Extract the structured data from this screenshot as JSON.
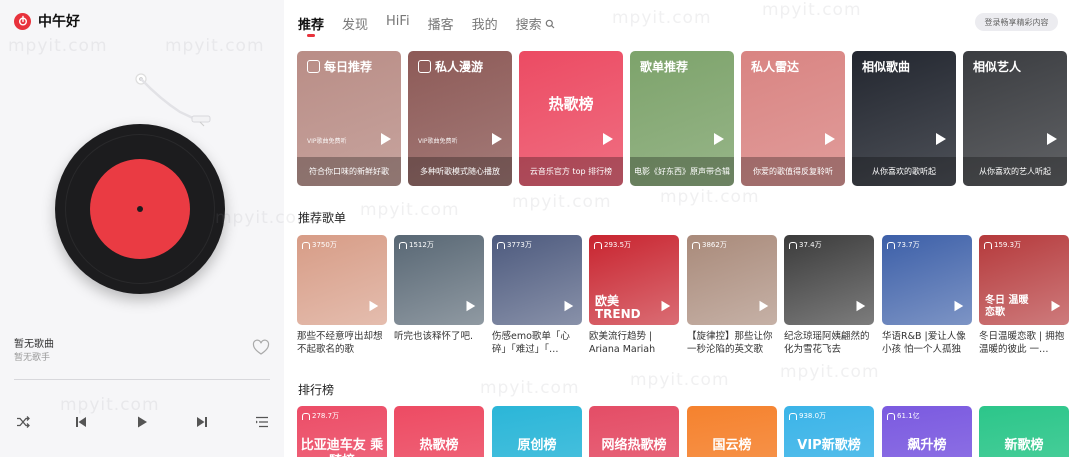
{
  "app": {
    "name": "中午好"
  },
  "player": {
    "song_title": "暂无歌曲",
    "song_artist": "暂无歌手"
  },
  "tabs": [
    {
      "label": "推荐",
      "active": true
    },
    {
      "label": "发现"
    },
    {
      "label": "HiFi"
    },
    {
      "label": "播客"
    },
    {
      "label": "我的"
    },
    {
      "label": "搜索"
    }
  ],
  "login_label": "登录畅享精彩内容",
  "feature_cards": [
    {
      "title": "每日推荐",
      "sub": "VIP歌曲免费听",
      "footer": "符合你口味的新鲜好歌",
      "color": "#b98d86",
      "icon": "calendar-icon"
    },
    {
      "title": "私人漫游",
      "sub": "VIP歌曲免费听",
      "footer": "多种听歌模式随心播放",
      "color": "#8d5a57",
      "icon": "radio-icon"
    },
    {
      "title": "",
      "big": "热歌榜",
      "footer": "云音乐官方 top 排行榜",
      "color": "#ec4b63"
    },
    {
      "title": "歌单推荐",
      "footer": "电影《好东西》原声带合辑",
      "color": "#7da36b"
    },
    {
      "title": "私人雷达",
      "footer": "你爱的歌值得反复聆听",
      "color": "#d98482"
    },
    {
      "title": "相似歌曲",
      "footer": "从你喜欢的歌听起",
      "color": "#22262f"
    },
    {
      "title": "相似艺人",
      "footer": "从你喜欢的艺人听起",
      "color": "#3a3c40"
    }
  ],
  "section_recommended": "推荐歌单",
  "playlists": [
    {
      "count": "3750万",
      "name": "那些不经意哼出却想不起歌名的歌",
      "color": "#d79c86"
    },
    {
      "count": "1512万",
      "name": "听完也该释怀了吧.",
      "color": "#586774"
    },
    {
      "count": "3773万",
      "name": "伤感emo歌单「心碎」「难过」「…",
      "color": "#4d5a7e"
    },
    {
      "count": "293.5万",
      "name": "欧美流行趋势 | Ariana Mariah Carey…",
      "color": "#c8242f",
      "overlay": "欧美 TREND"
    },
    {
      "count": "3862万",
      "name": "【旋律控】那些让你一秒沦陷的英文歌",
      "color": "#a98a7a"
    },
    {
      "count": "37.4万",
      "name": "纪念琼瑶阿姨翩然的化为雪花飞去",
      "color": "#3b3b3b"
    },
    {
      "count": "73.7万",
      "name": "华语R&B |爱让人像小孩 怕一个人孤独",
      "color": "#3c5fa8"
    },
    {
      "count": "159.3万",
      "name": "冬日温暖恋歌 | 拥抱温暖的彼此 一…",
      "color": "#b5393b",
      "overlay": "冬日 温暖恋歌"
    }
  ],
  "section_ranking": "排行榜",
  "rankings": [
    {
      "count": "278.7万",
      "name": "比亚迪车友 乘騎榜",
      "color": "#ec4d67"
    },
    {
      "count": "",
      "name": "热歌榜",
      "color": "#ed4b63"
    },
    {
      "count": "",
      "name": "原创榜",
      "color": "#2bb6d8"
    },
    {
      "count": "",
      "name": "网络热歌榜",
      "color": "#e44d66"
    },
    {
      "count": "",
      "name": "国云榜",
      "color": "#f5822e"
    },
    {
      "count": "938.0万",
      "name": "VIP新歌榜",
      "color": "#3bb4e8"
    },
    {
      "count": "61.1亿",
      "name": "飙升榜",
      "color": "#7b5ae0"
    },
    {
      "count": "",
      "name": "新歌榜",
      "color": "#2cc68a"
    }
  ],
  "watermark": "mpyit.com"
}
